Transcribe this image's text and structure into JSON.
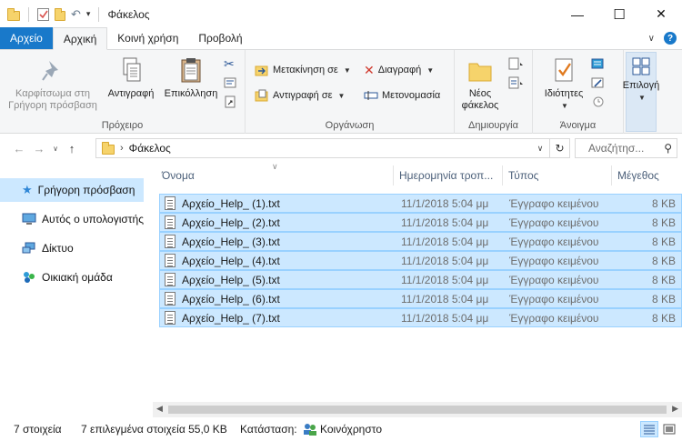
{
  "window": {
    "title": "Φάκελος",
    "minimize": "—",
    "maximize": "☐",
    "close": "✕"
  },
  "tabs": [
    {
      "label": "Αρχείο"
    },
    {
      "label": "Αρχική"
    },
    {
      "label": "Κοινή χρήση"
    },
    {
      "label": "Προβολή"
    }
  ],
  "ribbon": {
    "clipboard": {
      "label": "Πρόχειρο",
      "pin": "Καρφίτσωμα στη Γρήγορη πρόσβαση",
      "copy": "Αντιγραφή",
      "paste": "Επικόλληση"
    },
    "organize": {
      "label": "Οργάνωση",
      "move_to": "Μετακίνηση σε",
      "copy_to": "Αντιγραφή σε",
      "delete": "Διαγραφή",
      "rename": "Μετονομασία"
    },
    "new": {
      "label": "Δημιουργία",
      "new_folder": "Νέος φάκελος"
    },
    "open": {
      "label": "Άνοιγμα",
      "properties": "Ιδιότητες"
    },
    "select": {
      "label": "Επιλογή"
    }
  },
  "address": {
    "path": "Φάκελος",
    "search_placeholder": "Αναζήτησ..."
  },
  "nav": [
    {
      "label": "Γρήγορη πρόσβαση",
      "icon": "star-icon"
    },
    {
      "label": "Αυτός ο υπολογιστής",
      "icon": "computer-icon"
    },
    {
      "label": "Δίκτυο",
      "icon": "network-icon"
    },
    {
      "label": "Οικιακή ομάδα",
      "icon": "homegroup-icon"
    }
  ],
  "columns": {
    "name": "Όνομα",
    "date": "Ημερομηνία τροπ...",
    "type": "Τύπος",
    "size": "Μέγεθος"
  },
  "files": [
    {
      "name": "Αρχείο_Help_ (1).txt",
      "date": "11/1/2018 5:04 μμ",
      "type": "Έγγραφο κειμένου",
      "size": "8 KB"
    },
    {
      "name": "Αρχείο_Help_ (2).txt",
      "date": "11/1/2018 5:04 μμ",
      "type": "Έγγραφο κειμένου",
      "size": "8 KB"
    },
    {
      "name": "Αρχείο_Help_ (3).txt",
      "date": "11/1/2018 5:04 μμ",
      "type": "Έγγραφο κειμένου",
      "size": "8 KB"
    },
    {
      "name": "Αρχείο_Help_ (4).txt",
      "date": "11/1/2018 5:04 μμ",
      "type": "Έγγραφο κειμένου",
      "size": "8 KB"
    },
    {
      "name": "Αρχείο_Help_ (5).txt",
      "date": "11/1/2018 5:04 μμ",
      "type": "Έγγραφο κειμένου",
      "size": "8 KB"
    },
    {
      "name": "Αρχείο_Help_ (6).txt",
      "date": "11/1/2018 5:04 μμ",
      "type": "Έγγραφο κειμένου",
      "size": "8 KB"
    },
    {
      "name": "Αρχείο_Help_ (7).txt",
      "date": "11/1/2018 5:04 μμ",
      "type": "Έγγραφο κειμένου",
      "size": "8 KB"
    }
  ],
  "status": {
    "count": "7 στοιχεία",
    "selected": "7 επιλεγμένα στοιχεία 55,0 KB",
    "state_label": "Κατάσταση:",
    "state_value": "Κοινόχρηστο"
  },
  "colors": {
    "accent": "#1979ca",
    "selection": "#cce8ff",
    "selection_border": "#99d1ff"
  }
}
